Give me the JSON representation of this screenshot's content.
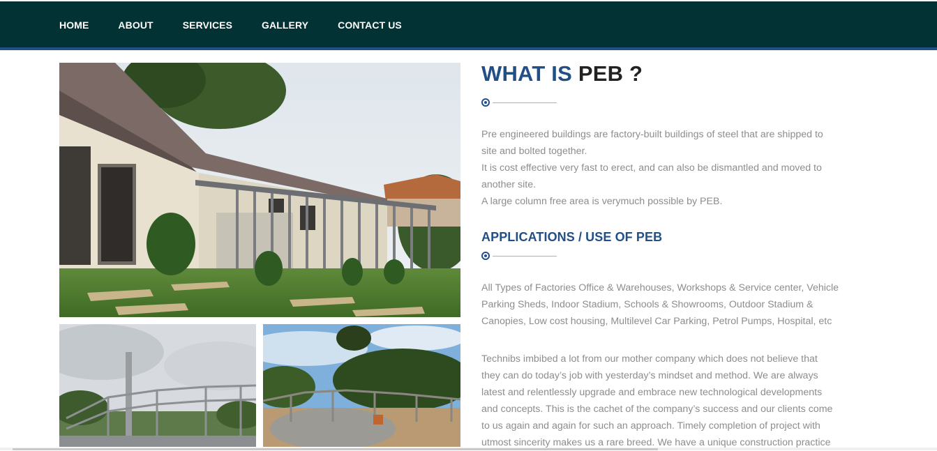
{
  "nav": {
    "items": [
      "HOME",
      "ABOUT",
      "SERVICES",
      "GALLERY",
      "CONTACT US"
    ]
  },
  "main": {
    "heading_blue": "WHAT IS",
    "heading_dark": "PEB ?",
    "intro_lines": [
      "Pre engineered buildings are factory-built buildings of steel that are shipped to",
      "site and bolted together.",
      "It is cost effective very fast to erect, and can also be dismantled and moved to",
      "another site.",
      "A large column free area is verymuch possible by PEB."
    ],
    "applications_heading": "APPLICATIONS / USE OF PEB",
    "applications_lines": [
      "All Types of Factories Office & Warehouses, Workshops & Service center, Vehicle",
      "Parking Sheds, Indoor Stadium, Schools & Showrooms, Outdoor Stadium &",
      "Canopies, Low cost housing, Multilevel Car Parking, Petrol Pumps, Hospital, etc"
    ],
    "company_lines": [
      "Technibs imbibed a lot from our mother company which does not believe that",
      "they can do today’s job with yesterday’s mindset and method. We are always",
      "latest and relentlessly upgrade and embrace new technological developments",
      "and concepts. This is the cachet of the company’s success and our clients come",
      "to us again and again for such an approach. Timely completion of project with",
      "utmost sincerity makes us a rare breed. We have a unique construction practice"
    ]
  },
  "colors": {
    "nav_bg": "#033234",
    "accent_blue": "#214f86",
    "body_text": "#8d8d8d"
  }
}
